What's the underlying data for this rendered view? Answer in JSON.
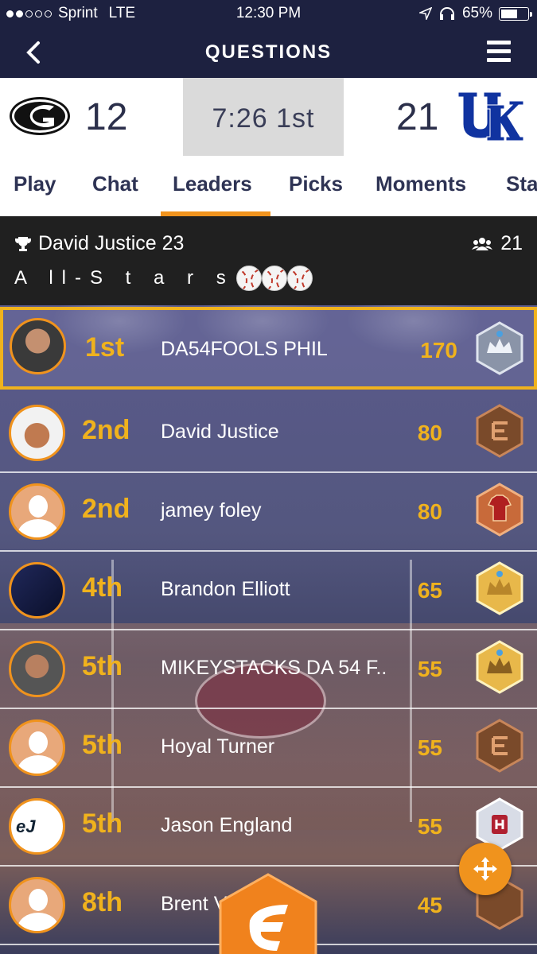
{
  "status_bar": {
    "carrier": "Sprint",
    "network": "LTE",
    "time": "12:30 PM",
    "battery": "65%",
    "battery_level": 0.65,
    "icons": [
      "signal-dots-icon",
      "location-arrow-icon",
      "headphones-icon",
      "battery-icon"
    ]
  },
  "nav": {
    "title": "QUESTIONS",
    "back_icon": "chevron-left-icon",
    "menu_icon": "hamburger-menu-icon"
  },
  "scoreboard": {
    "home_score": "12",
    "clock": "7:26 1st",
    "away_score": "21",
    "home_logo_text": "G",
    "away_logo_text": "UK"
  },
  "tabs": [
    {
      "label": "Play"
    },
    {
      "label": "Chat"
    },
    {
      "label": "Leaders",
      "active": true
    },
    {
      "label": "Picks"
    },
    {
      "label": "Moments"
    },
    {
      "label": "Sta"
    }
  ],
  "league": {
    "leader_text": "David Justice 23",
    "member_count": "21",
    "name": "A ll-S t a r s",
    "trophy_icon": "trophy-icon",
    "members_icon": "people-icon"
  },
  "leaderboard": [
    {
      "rank": "1st",
      "name": "DA54FOOLS PHIL",
      "points": "170",
      "highlighted": true
    },
    {
      "rank": "2nd",
      "name": "David Justice",
      "points": "80"
    },
    {
      "rank": "2nd",
      "name": "jamey foley",
      "points": "80"
    },
    {
      "rank": "4th",
      "name": "Brandon Elliott",
      "points": "65"
    },
    {
      "rank": "5th",
      "name": "MIKEYSTACKS DA 54 F..",
      "points": "55"
    },
    {
      "rank": "5th",
      "name": "Hoyal Turner",
      "points": "55"
    },
    {
      "rank": "5th",
      "name": "Jason England",
      "points": "55"
    },
    {
      "rank": "8th",
      "name": "Brent V",
      "points": "45"
    }
  ],
  "colors": {
    "navy": "#1d2140",
    "accent_orange": "#f0931d",
    "rank_gold": "#f0b21d"
  },
  "fab_icon": "move-arrows-icon",
  "logo_icon": "fanduel-hex-logo-icon"
}
